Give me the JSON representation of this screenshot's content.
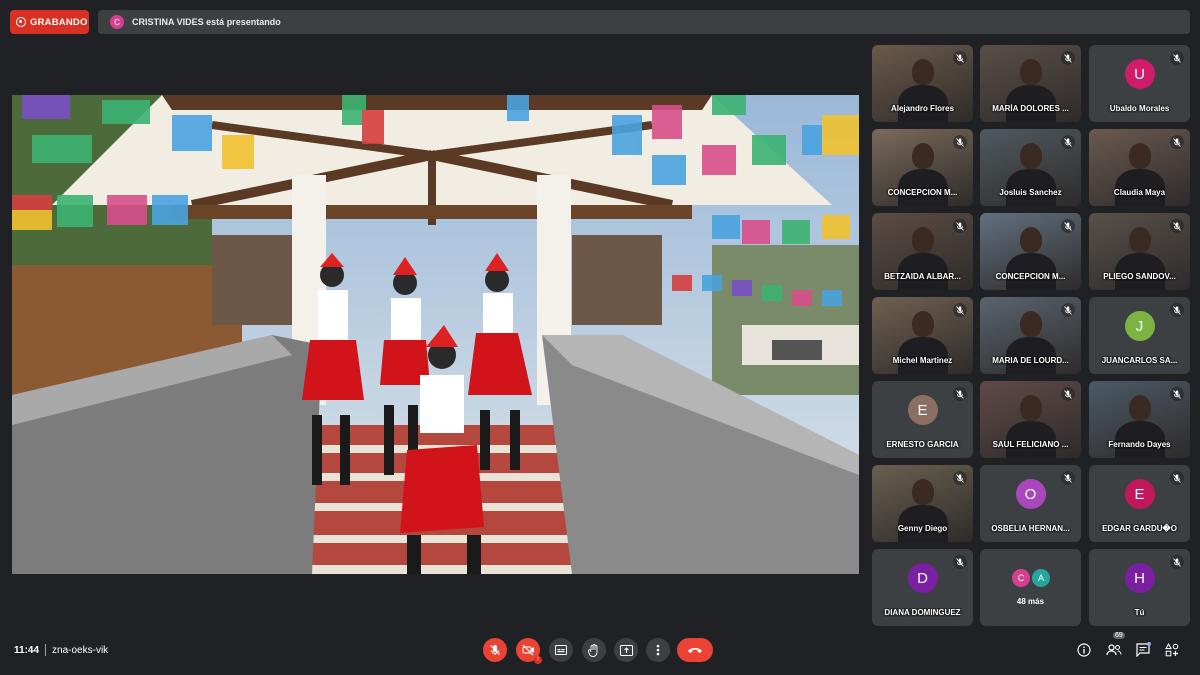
{
  "recording": {
    "label": "GRABANDO",
    "color": "#d93025"
  },
  "presenting": {
    "avatar_letter": "C",
    "text": "CRISTINA VIDES está presentando"
  },
  "participants": [
    {
      "name": "Alejandro Flores",
      "type": "video"
    },
    {
      "name": "MARÍA DOLORES ...",
      "type": "video"
    },
    {
      "name": "Ubaldo Morales",
      "type": "avatar",
      "letter": "U",
      "color": "#d01c6a"
    },
    {
      "name": "CONCEPCION M...",
      "type": "video"
    },
    {
      "name": "Josluis Sanchez",
      "type": "video"
    },
    {
      "name": "Claudia Maya",
      "type": "video"
    },
    {
      "name": "BETZAIDA ALBAR...",
      "type": "video"
    },
    {
      "name": "CONCEPCION M...",
      "type": "video"
    },
    {
      "name": "PLIEGO SANDOV...",
      "type": "video"
    },
    {
      "name": "Michel Martinez",
      "type": "video"
    },
    {
      "name": "MARIA DE LOURD...",
      "type": "video"
    },
    {
      "name": "JUANCARLOS SA...",
      "type": "avatar",
      "letter": "J",
      "color": "#7cb342"
    },
    {
      "name": "ERNESTO GARCIA",
      "type": "avatar",
      "letter": "E",
      "color": "#8d6e63"
    },
    {
      "name": "SAUL FELICIANO ...",
      "type": "video"
    },
    {
      "name": "Fernando Dayes",
      "type": "video"
    },
    {
      "name": "Genny Diego",
      "type": "video"
    },
    {
      "name": "OSBELIA HERNAN...",
      "type": "avatar",
      "letter": "O",
      "color": "#ab47bc"
    },
    {
      "name": "EDGAR GARDU�O",
      "type": "avatar",
      "letter": "E",
      "color": "#c2185b"
    },
    {
      "name": "DIANA DOMINGUEZ",
      "type": "avatar",
      "letter": "D",
      "color": "#7b1fa2"
    },
    {
      "name": "48 más",
      "type": "more",
      "letters": [
        "C",
        "A"
      ],
      "colors": [
        "#d63f8c",
        "#26a69a"
      ]
    },
    {
      "name": "Tú",
      "type": "avatar",
      "letter": "H",
      "color": "#7b1fa2"
    }
  ],
  "bottom": {
    "time": "11:44",
    "meeting_code": "zna-oeks-vik",
    "participant_count": "69"
  },
  "icons": {
    "controls": [
      "mic-off-icon",
      "camera-off-icon",
      "captions-icon",
      "raise-hand-icon",
      "present-icon",
      "more-options-icon",
      "end-call-icon"
    ],
    "right": [
      "info-icon",
      "people-icon",
      "chat-icon",
      "activities-icon"
    ]
  }
}
